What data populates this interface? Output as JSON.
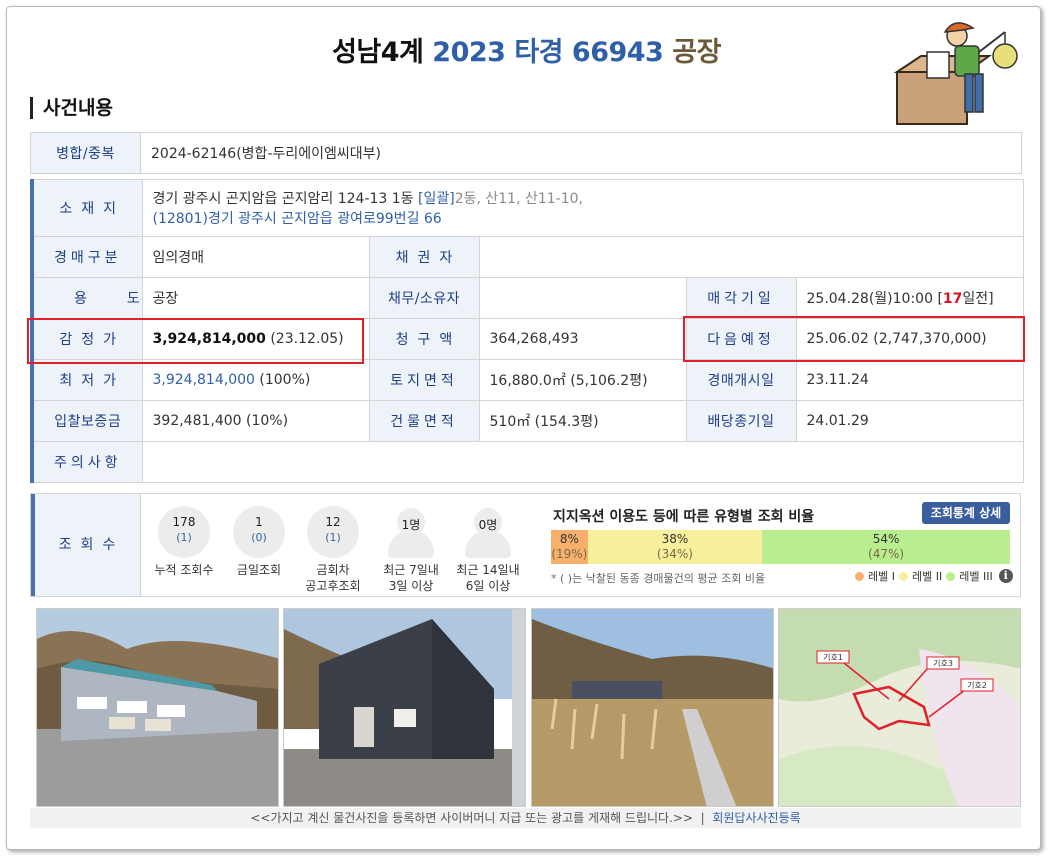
{
  "title": {
    "court": "성남4계",
    "case": "2023 타경 66943",
    "type": "공장"
  },
  "section_title": "사건내용",
  "merge": {
    "label": "병합/중복",
    "value": "2024-62146(병합-두리에이엠씨대부)"
  },
  "location": {
    "label": "소재지",
    "line1_main": "경기 광주시 곤지암읍 곤지암리 124-13 1동 ",
    "line1_tag": "[일괄]",
    "line1_extra": "2동, 산11, 산11-10,",
    "line2": "(12801)경기 광주시  곤지암읍 광여로99번길  66"
  },
  "rows": {
    "auction_type": {
      "label": "경매구분",
      "value": "임의경매"
    },
    "creditor": {
      "label": "채권자",
      "value": ""
    },
    "usage": {
      "label": "용도",
      "value": "공장"
    },
    "debtor": {
      "label": "채무/소유자",
      "value": ""
    },
    "sale_date": {
      "label": "매각기일",
      "value_pre": "25.04.28(월)10:00 [",
      "value_days": "17",
      "value_post": "일전]"
    },
    "appraisal": {
      "label": "감정가",
      "value_amount": "3,924,814,000",
      "value_date": " (23.12.05)"
    },
    "claim": {
      "label": "청구액",
      "value": "364,268,493"
    },
    "next": {
      "label": "다음예정",
      "value": "25.06.02 (2,747,370,000)"
    },
    "minimum": {
      "label": "최저가",
      "value_amount": "3,924,814,000",
      "value_rate": " (100%)"
    },
    "land_area": {
      "label": "토지면적",
      "value": "16,880.0㎡ (5,106.2평)"
    },
    "start_date": {
      "label": "경매개시일",
      "value": "23.11.24"
    },
    "deposit": {
      "label": "입찰보증금",
      "value": "392,481,400 (10%)"
    },
    "building_area": {
      "label": "건물면적",
      "value": "510㎡ (154.3평)"
    },
    "dividend_date": {
      "label": "배당종기일",
      "value": "24.01.29"
    },
    "notes": {
      "label": "주의사항",
      "value": ""
    }
  },
  "views": {
    "label": "조회수",
    "stats": [
      {
        "num": "178",
        "sub": "(1)",
        "cap1": "누적 조회수",
        "cap2": ""
      },
      {
        "num": "1",
        "sub": "(0)",
        "cap1": "금일조회",
        "cap2": ""
      },
      {
        "num": "12",
        "sub": "(1)",
        "cap1": "금회차",
        "cap2": "공고후조회"
      }
    ],
    "people": [
      {
        "num": "1명",
        "cap1": "최근 7일내",
        "cap2": "3일 이상"
      },
      {
        "num": "0명",
        "cap1": "최근 14일내",
        "cap2": "6일 이상"
      }
    ]
  },
  "ratio": {
    "title": "지지옥션 이용도 등에 따른 유형별 조회 비율",
    "button": "조회통계 상세",
    "segments": [
      {
        "pct": "8%",
        "avg": "(19%)",
        "value": 8,
        "color": "#f6b06c"
      },
      {
        "pct": "38%",
        "avg": "(34%)",
        "value": 38,
        "color": "#f8ef9d"
      },
      {
        "pct": "54%",
        "avg": "(47%)",
        "value": 54,
        "color": "#b9ee8f"
      }
    ],
    "note": "* ( )는 낙찰된 동종 경매물건의 평균 조회 비율",
    "legend": [
      {
        "label": "레벨 I",
        "color": "#f6b06c"
      },
      {
        "label": "레벨 II",
        "color": "#f8ef9d"
      },
      {
        "label": "레벨 III",
        "color": "#b9ee8f"
      }
    ],
    "info_glyph": "i"
  },
  "map_labels": {
    "a": "기호1",
    "b": "기호3",
    "c": "기호2"
  },
  "footer": {
    "text": "<<가지고 계신 물건사진을 등록하면 사이버머니 지급 또는 광고를 게재해 드립니다.>>",
    "sep": "  |  ",
    "link": "회원답사사진등록"
  }
}
